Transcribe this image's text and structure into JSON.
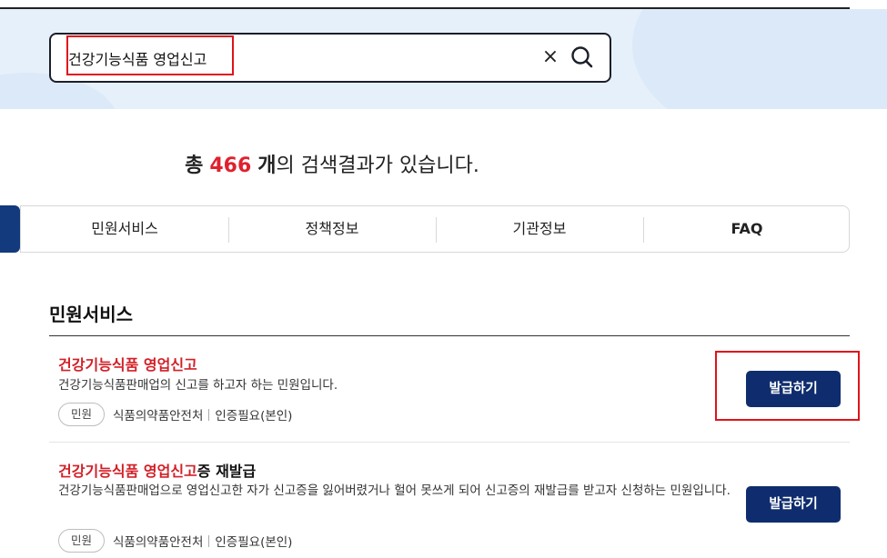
{
  "search": {
    "query": "건강기능식품 영업신고",
    "clear_label": "×"
  },
  "summary": {
    "prefix": "총",
    "count": "466",
    "unit": "개",
    "suffix": "의 검색결과가 있습니다."
  },
  "tabs": [
    {
      "label": "민원서비스"
    },
    {
      "label": "정책정보"
    },
    {
      "label": "기관정보"
    },
    {
      "label": "FAQ"
    }
  ],
  "section": {
    "title": "민원서비스"
  },
  "results": [
    {
      "title_highlight": "건강기능식품 영업신고",
      "title_rest": "",
      "description": "건강기능식품판매업의 신고를 하고자 하는 민원입니다.",
      "badge": "민원",
      "agency": "식품의약품안전처",
      "auth": "인증필요(본인)",
      "button": "발급하기"
    },
    {
      "title_highlight": "건강기능식품 영업신고",
      "title_rest": "증 재발급",
      "description": "건강기능식품판매업으로 영업신고한 자가 신고증을 잃어버렸거나 헐어 못쓰게 되어 신고증의 재발급를 받고자 신청하는 민원입니다.",
      "badge": "민원",
      "agency": "식품의약품안전처",
      "auth": "인증필요(본인)",
      "button": "발급하기"
    }
  ],
  "colors": {
    "accent_navy": "#0f2d6e",
    "highlight_red": "#d21f27",
    "annotation_red": "#e0131b",
    "banner_bg": "#e6f0fb"
  },
  "icons": [
    "search-icon",
    "close-icon"
  ]
}
